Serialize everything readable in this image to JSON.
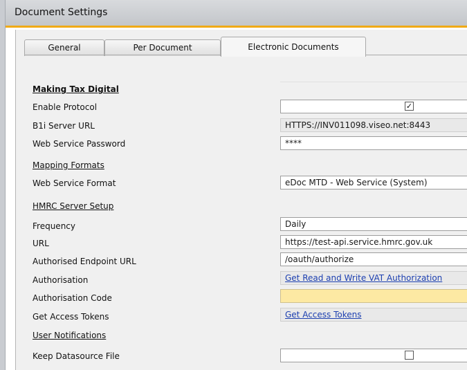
{
  "window": {
    "title": "Document Settings"
  },
  "tabs": [
    {
      "label": "General"
    },
    {
      "label": "Per Document"
    },
    {
      "label": "Electronic Documents"
    }
  ],
  "mtd": {
    "heading": "Making Tax Digital",
    "enable_protocol": {
      "label": "Enable Protocol",
      "checked": true,
      "check_glyph": "✓"
    },
    "b1i_url": {
      "label": "B1i Server URL",
      "value": "HTTPS://INV011098.viseo.net:8443"
    },
    "ws_password": {
      "label": "Web Service Password",
      "value": "****"
    }
  },
  "mapping": {
    "heading": "Mapping Formats",
    "ws_format": {
      "label": "Web Service Format",
      "value": "eDoc MTD - Web Service (System)"
    }
  },
  "hmrc": {
    "heading": "HMRC Server Setup",
    "frequency": {
      "label": "Frequency",
      "value": "Daily"
    },
    "url": {
      "label": "URL",
      "value": "https://test-api.service.hmrc.gov.uk"
    },
    "auth_endpoint": {
      "label": "Authorised Endpoint URL",
      "value": "/oauth/authorize"
    },
    "authorisation": {
      "label": "Authorisation",
      "link": "Get Read and Write VAT Authorization"
    },
    "auth_code": {
      "label": "Authorisation Code",
      "value": ""
    },
    "access_tokens": {
      "label": "Get Access Tokens",
      "link": "Get Access Tokens"
    }
  },
  "notifications": {
    "heading": "User Notifications",
    "keep_datasource": {
      "label": "Keep Datasource File",
      "checked": false
    }
  }
}
